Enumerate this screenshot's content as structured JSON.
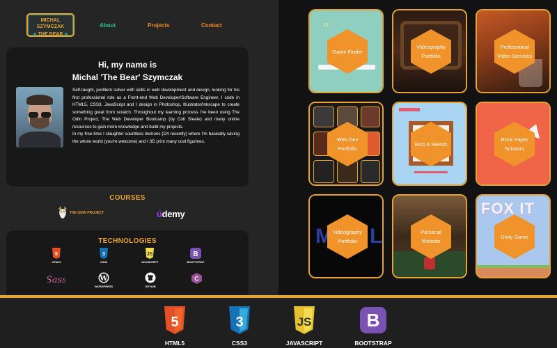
{
  "logo": {
    "line1": "MICHAL SZYMCZAK",
    "line2": "THE BEAR",
    "star": "★"
  },
  "nav": {
    "about": "About",
    "projects": "Projects",
    "contact": "Contact"
  },
  "about": {
    "greeting_line1": "Hi, my name is",
    "greeting_line2": "Michal 'The Bear' Szymczak",
    "bio_p1": "Self-taught, problem solver with skills in web development and design, looking for his first professional role as a Front-end Web Developer/Software Engineer. I code in HTML5, CSS3, JavaScript and I design in Photoshop, Illustrator/Inkscape to create something great from scratch. Throughout my learning process I've been using The Odin Project, The Web Developer Bootcamp (by Colt Steele) and many online resources to gain more knowledge and build my projects.",
    "bio_p2": "In my free time I slaughter countless demons (D4 recently) where I'm basically saving the whole world (you're welcome) and I 3D print many cool figurines."
  },
  "courses": {
    "title": "COURSES",
    "odin": "THE ODIN PROJECT",
    "udemy_u": "ú",
    "udemy_rest": "demy"
  },
  "technologies": {
    "title": "TECHNOLOGIES",
    "items": [
      {
        "label": "HTML5",
        "icon": "html5-icon",
        "color": "#e34f26"
      },
      {
        "label": "CSS3",
        "icon": "css3-icon",
        "color": "#1572b6"
      },
      {
        "label": "JAVASCRIPT",
        "icon": "javascript-icon",
        "color": "#f0db4f"
      },
      {
        "label": "BOOTSTRAP",
        "icon": "bootstrap-icon",
        "color": "#7952b3"
      },
      {
        "label": "",
        "icon": "sass-icon",
        "color": "#cd6799"
      },
      {
        "label": "WORDPRESS",
        "icon": "wordpress-icon",
        "color": "#ffffff"
      },
      {
        "label": "GITHUB",
        "icon": "github-icon",
        "color": "#ffffff"
      },
      {
        "label": "",
        "icon": "csharp-icon",
        "color": "#9b4f96"
      }
    ]
  },
  "projects": [
    {
      "title": "Game Finder",
      "icon": "game-finder-thumbnail"
    },
    {
      "title": "Videography Portfolio",
      "icon": "videography-thumbnail"
    },
    {
      "title": "Professional Video Services",
      "icon": "video-services-thumbnail"
    },
    {
      "title": "Web Dev Portfolio",
      "icon": "webdev-thumbnail"
    },
    {
      "title": "Etch A Sketch",
      "icon": "etch-a-sketch-thumbnail"
    },
    {
      "title": "Rock Paper Scissors",
      "icon": "rps-thumbnail"
    },
    {
      "title": "Videography Portfolio",
      "icon": "videography2-thumbnail"
    },
    {
      "title": "Personal Website",
      "icon": "personal-website-thumbnail"
    },
    {
      "title": "Unity Game",
      "icon": "unity-game-thumbnail"
    }
  ],
  "bottom_bar": {
    "items": [
      {
        "label": "HTML5",
        "icon": "html5-icon",
        "color": "#e34f26"
      },
      {
        "label": "CSS3",
        "icon": "css3-icon",
        "color": "#1572b6"
      },
      {
        "label": "JAVASCRIPT",
        "icon": "javascript-icon",
        "color": "#f0db4f"
      },
      {
        "label": "BOOTSTRAP",
        "icon": "bootstrap-icon",
        "color": "#7952b3"
      }
    ]
  },
  "colors": {
    "accent": "#e8a230",
    "teal": "#27c39f",
    "hex": "#f0932b"
  }
}
